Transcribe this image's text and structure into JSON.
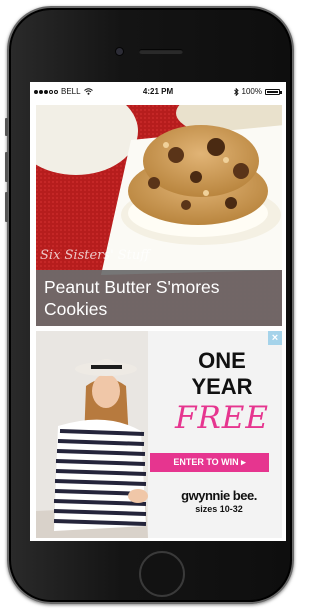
{
  "status_bar": {
    "carrier": "BELL",
    "time": "4:21 PM",
    "battery_percent": "100%"
  },
  "article": {
    "watermark": "Six Sisters' Stuff",
    "title": "Peanut Butter S'mores Cookies"
  },
  "ad": {
    "close_label": "×",
    "headline_line1": "ONE",
    "headline_line2": "YEAR",
    "headline_line3": "FREE",
    "cta_label": "ENTER TO WIN ▸",
    "brand": "gwynnie bee.",
    "sizes": "sizes 10-32"
  },
  "colors": {
    "ad_accent": "#e6358f",
    "caption_bg": "#6c6c6c",
    "ad_close_bg": "#a5d3ea"
  },
  "icons": [
    "signal-dots-icon",
    "wifi-icon",
    "bluetooth-icon",
    "battery-icon",
    "close-icon"
  ]
}
